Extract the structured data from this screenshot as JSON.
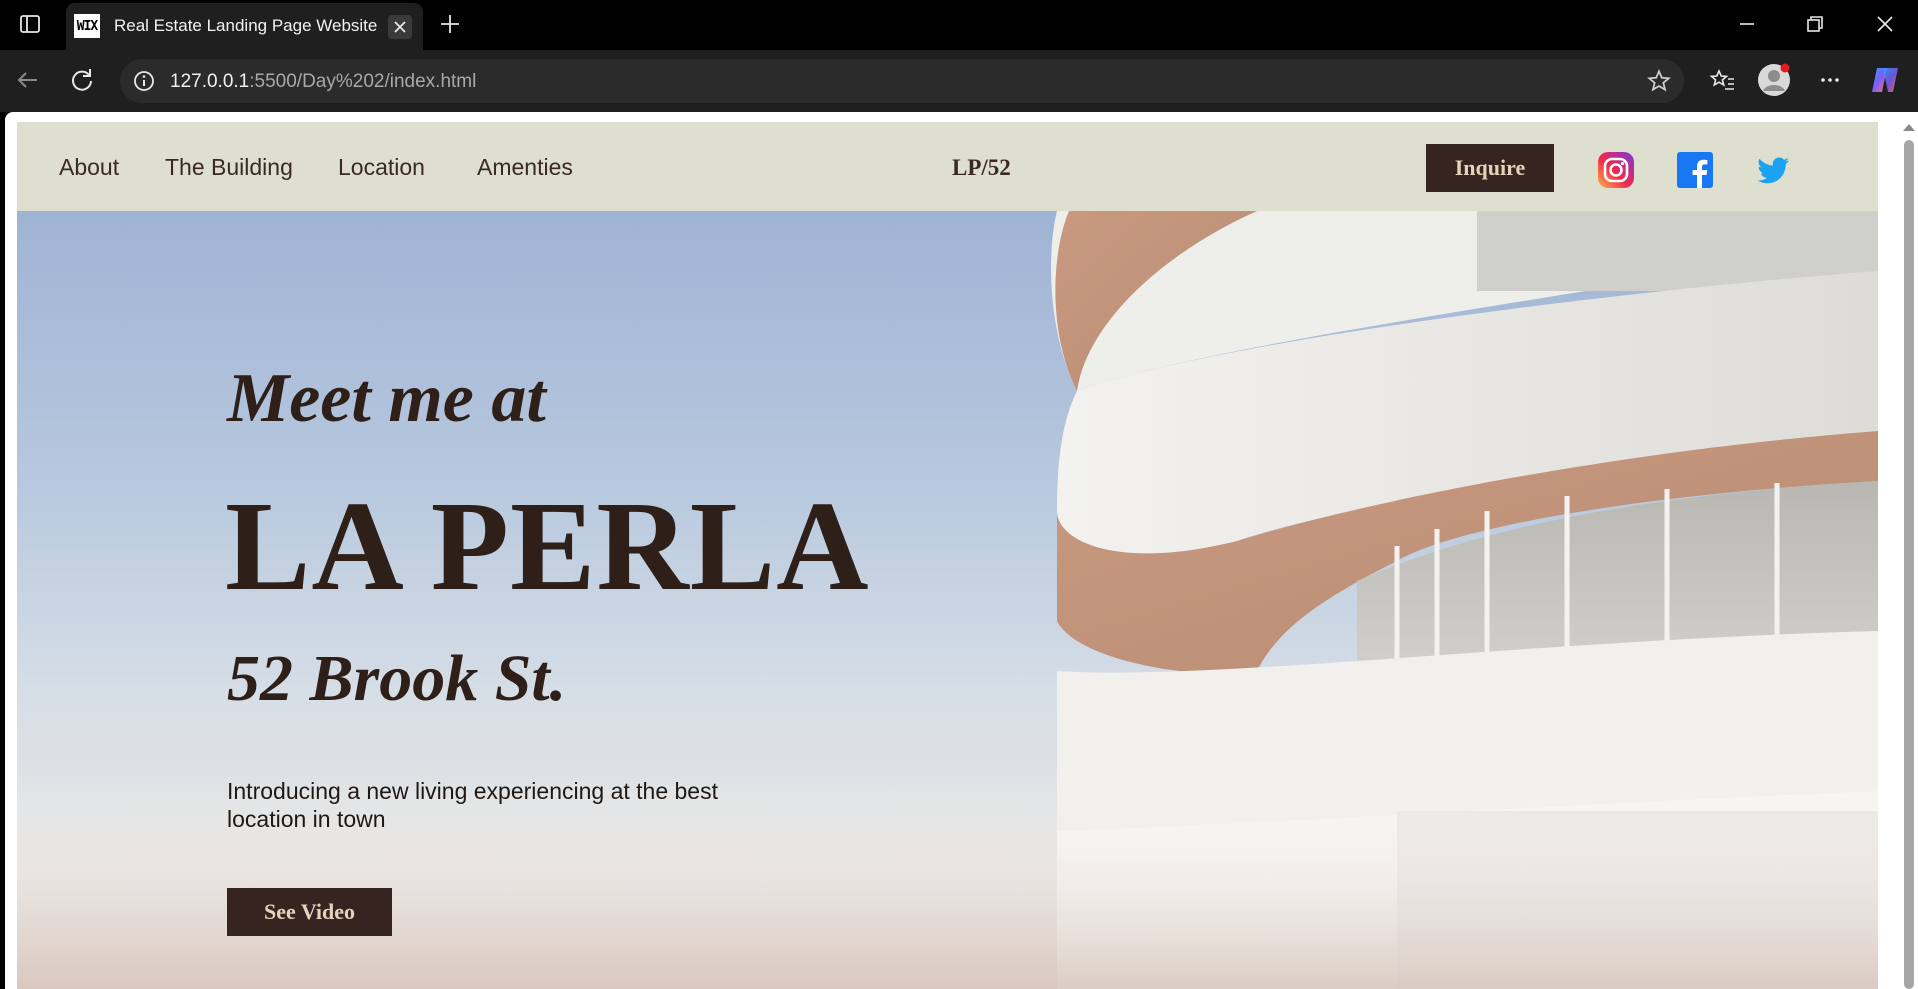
{
  "browser": {
    "tab_title": "Real Estate Landing Page Website",
    "tab_favicon_text": "WIX",
    "url_host": "127.0.0.1",
    "url_rest": ":5500/Day%202/index.html"
  },
  "nav": {
    "links": [
      "About",
      "The Building",
      "Location",
      "Amenties"
    ],
    "brand": "LP/52",
    "inquire_label": "Inquire",
    "social": [
      "instagram-icon",
      "facebook-icon",
      "twitter-icon"
    ]
  },
  "hero": {
    "line1": "Meet me at",
    "title": "LA PERLA",
    "address": "52 Brook St.",
    "intro": "Introducing a new living experiencing at the best location in town",
    "cta_label": "See Video"
  },
  "colors": {
    "nav_bg": "#dfdfcf",
    "button_bg": "#35241f",
    "button_text": "#e6d2bc",
    "heading_text": "#2e1f19"
  }
}
